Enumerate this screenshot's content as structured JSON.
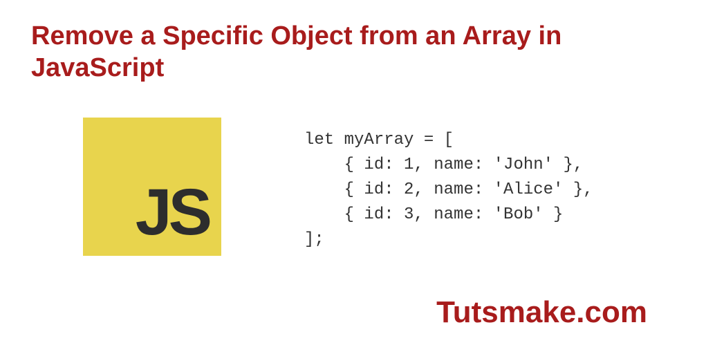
{
  "title": "Remove a Specific Object from an Array in JavaScript",
  "jsLogo": {
    "text": "JS"
  },
  "code": "let myArray = [\n    { id: 1, name: 'John' },\n    { id: 2, name: 'Alice' },\n    { id: 3, name: 'Bob' }\n];",
  "footer": "Tutsmake.com"
}
